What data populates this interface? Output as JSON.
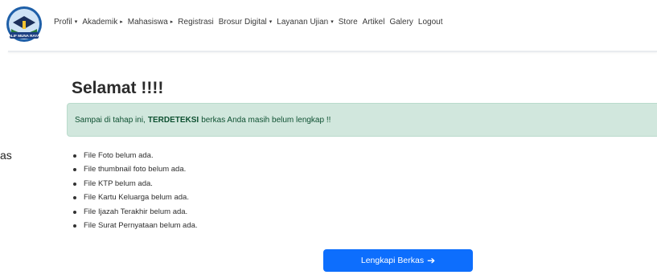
{
  "navbar": {
    "logo_text": "ALIF MUNA RAYA",
    "items": [
      {
        "label": "Profil",
        "has_dropdown": true,
        "caret": "▾"
      },
      {
        "label": "Akademik",
        "has_dropdown": true,
        "caret": "▸"
      },
      {
        "label": "Mahasiswa",
        "has_dropdown": true,
        "caret": "▸"
      },
      {
        "label": "Registrasi",
        "has_dropdown": false,
        "caret": ""
      },
      {
        "label": "Brosur Digital",
        "has_dropdown": true,
        "caret": "▾"
      },
      {
        "label": "Layanan Ujian",
        "has_dropdown": true,
        "caret": "▾"
      },
      {
        "label": "Store",
        "has_dropdown": false,
        "caret": ""
      },
      {
        "label": "Artikel",
        "has_dropdown": false,
        "caret": ""
      },
      {
        "label": "Galery",
        "has_dropdown": false,
        "caret": ""
      },
      {
        "label": "Logout",
        "has_dropdown": false,
        "caret": ""
      }
    ]
  },
  "left_fragment": "as",
  "main": {
    "heading": "Selamat !!!!",
    "alert": {
      "prefix": "Sampai di tahap ini,",
      "emphasis": "TERDETEKSI",
      "suffix": "berkas Anda masih belum lengkap !!"
    },
    "missing_files": [
      "File Foto belum ada.",
      "File thumbnail foto belum ada.",
      "File KTP belum ada.",
      "File Kartu Keluarga belum ada.",
      "File Ijazah Terakhir belum ada.",
      "File Surat Pernyataan belum ada."
    ],
    "button": {
      "label": "Lengkapi Berkas",
      "icon": "arrow-right-icon"
    }
  },
  "colors": {
    "primary": "#0d6efd",
    "alert_bg": "#d1e7dd",
    "alert_text": "#0f5132"
  }
}
